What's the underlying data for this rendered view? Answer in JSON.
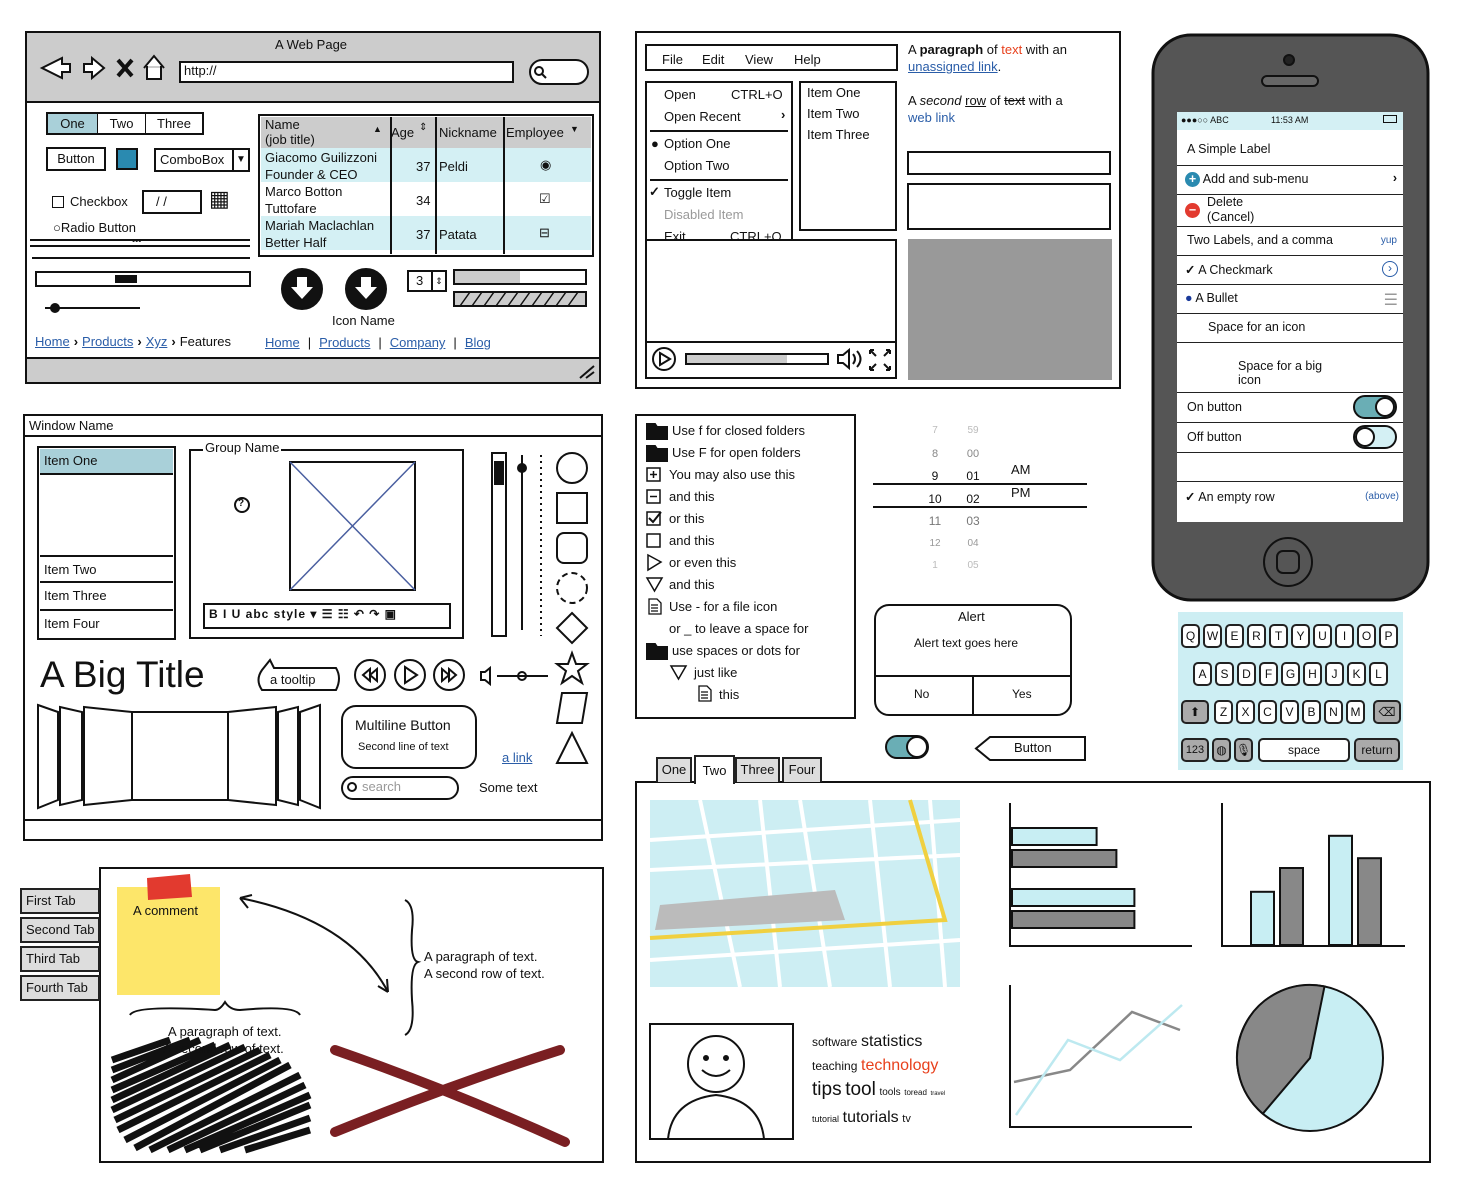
{
  "browser": {
    "title": "A Web Page",
    "url": "http://",
    "tabs": [
      "One",
      "Two",
      "Three"
    ],
    "button": "Button",
    "combobox": "ComboBox",
    "checkbox": "Checkbox",
    "date": "/ /",
    "radio": "Radio Button",
    "table": {
      "headers": [
        "Name\n(job title)",
        "Age",
        "Nickname",
        "Employee"
      ],
      "rows": [
        {
          "name": "Giacomo Guilizzoni",
          "title": "Founder & CEO",
          "age": "37",
          "nick": "Peldi",
          "employee": "radio"
        },
        {
          "name": "Marco Botton",
          "title": "Tuttofare",
          "age": "34",
          "nick": "",
          "employee": "checkbox"
        },
        {
          "name": "Mariah Maclachlan",
          "title": "Better Half",
          "age": "37",
          "nick": "Patata",
          "employee": "indeterminate"
        }
      ]
    },
    "icon_name": "Icon Name",
    "stepper": "3",
    "progress": 0.5,
    "breadcrumb": [
      "Home",
      "Products",
      "Xyz",
      "Features"
    ],
    "links": [
      "Home",
      "Products",
      "Company",
      "Blog"
    ]
  },
  "menu": {
    "bar": [
      "File",
      "Edit",
      "View",
      "Help"
    ],
    "items": [
      {
        "label": "Open",
        "shortcut": "CTRL+O"
      },
      {
        "label": "Open Recent",
        "shortcut": "›"
      },
      {
        "label": "Option One"
      },
      {
        "label": "Option Two"
      },
      {
        "label": "Toggle Item"
      },
      {
        "label": "Disabled Item"
      },
      {
        "label": "Exit",
        "shortcut": "CTRL+Q"
      }
    ],
    "list": [
      "Item One",
      "Item Two",
      "Item Three"
    ]
  },
  "paragraph": {
    "p1": [
      "A ",
      "paragraph",
      " of ",
      "text",
      " with an ",
      "unassigned link",
      "."
    ],
    "p2": [
      "A ",
      "second",
      " ",
      "row",
      " of ",
      "text",
      " with a ",
      "web link"
    ],
    "accent": "#e8401c"
  },
  "phone": {
    "status": {
      "carrier": "●●●○○ ABC",
      "time": "11:53 AM"
    },
    "rows": [
      "A Simple Label",
      "Add and sub-menu",
      "Delete\n(Cancel)",
      "Two Labels, and a comma",
      "A Checkmark",
      "A Bullet",
      "Space for an icon",
      "Space for a big icon",
      "On button",
      "Off button",
      "",
      "An empty row"
    ],
    "two_labels_right": "yup",
    "empty_row_right": "(above)"
  },
  "keyboard": {
    "row1": [
      "Q",
      "W",
      "E",
      "R",
      "T",
      "Y",
      "U",
      "I",
      "O",
      "P"
    ],
    "row2": [
      "A",
      "S",
      "D",
      "F",
      "G",
      "H",
      "J",
      "K",
      "L"
    ],
    "row3": [
      "Z",
      "X",
      "C",
      "V",
      "B",
      "N",
      "M"
    ],
    "numbers": "123",
    "space": "space",
    "return": "return"
  },
  "window": {
    "title": "Window Name",
    "list": [
      "Item One",
      "Item Two",
      "Item Three",
      "Item Four"
    ],
    "group": "Group Name",
    "big_title": "A Big Title",
    "tooltip": "a tooltip",
    "multiline": {
      "line1": "Multiline Button",
      "line2": "Second line of text"
    },
    "link": "a link",
    "search_placeholder": "search",
    "some_text": "Some text",
    "toolbar": "B I U abc style ▾ ☰ ☷ ↶ ↷ ▣"
  },
  "tree": [
    "Use f for closed folders",
    "Use F for open folders",
    "You may also use this",
    "and this",
    "or this",
    "and this",
    "or even this",
    "and this",
    "Use - for a file icon",
    "or _ to leave a space for",
    "use spaces or dots for",
    "just like",
    "this"
  ],
  "picker": {
    "hours": [
      "7",
      "8",
      "9",
      "10",
      "11",
      "12",
      "1"
    ],
    "minutes": [
      "59",
      "00",
      "01",
      "02",
      "03",
      "04",
      "05"
    ],
    "ampm": [
      "AM",
      "PM"
    ]
  },
  "alert": {
    "title": "Alert",
    "text": "Alert text goes here",
    "no": "No",
    "yes": "Yes"
  },
  "back_button": "Button",
  "vtabs": [
    "First Tab",
    "Second Tab",
    "Third Tab",
    "Fourth Tab"
  ],
  "notes": {
    "comment": "A comment",
    "para1": "A paragraph of text.",
    "para2": "A second row of text."
  },
  "tabs2": [
    "One",
    "Two",
    "Three",
    "Four"
  ],
  "tabs2_selected": "Two",
  "charts": {
    "hbar": [
      {
        "v": 0.47,
        "c": "#c8eef3"
      },
      {
        "v": 0.58,
        "c": "#888"
      },
      {
        "v": 0.68,
        "c": "#c8eef3"
      },
      {
        "v": 0.68,
        "c": "#888"
      }
    ],
    "vbar": [
      {
        "v": 0.38,
        "c": "#c8eef3"
      },
      {
        "v": 0.55,
        "c": "#888"
      },
      {
        "v": 0.78,
        "c": "#c8eef3"
      },
      {
        "v": 0.62,
        "c": "#888"
      }
    ],
    "pie": {
      "gray": 0.42,
      "blue": 0.58
    }
  },
  "cloud": [
    {
      "w": "software",
      "s": 12
    },
    {
      "w": "statistics",
      "s": 16
    },
    {
      "w": "teaching",
      "s": 12
    },
    {
      "w": "technology",
      "s": 16,
      "c": "#e8401c"
    },
    {
      "w": "tips",
      "s": 19
    },
    {
      "w": "tool",
      "s": 19
    },
    {
      "w": "tools",
      "s": 10
    },
    {
      "w": "toread",
      "s": 8
    },
    {
      "w": "travel",
      "s": 6
    },
    {
      "w": "tutorial",
      "s": 9
    },
    {
      "w": "tutorials",
      "s": 16
    },
    {
      "w": "tv",
      "s": 11
    }
  ]
}
